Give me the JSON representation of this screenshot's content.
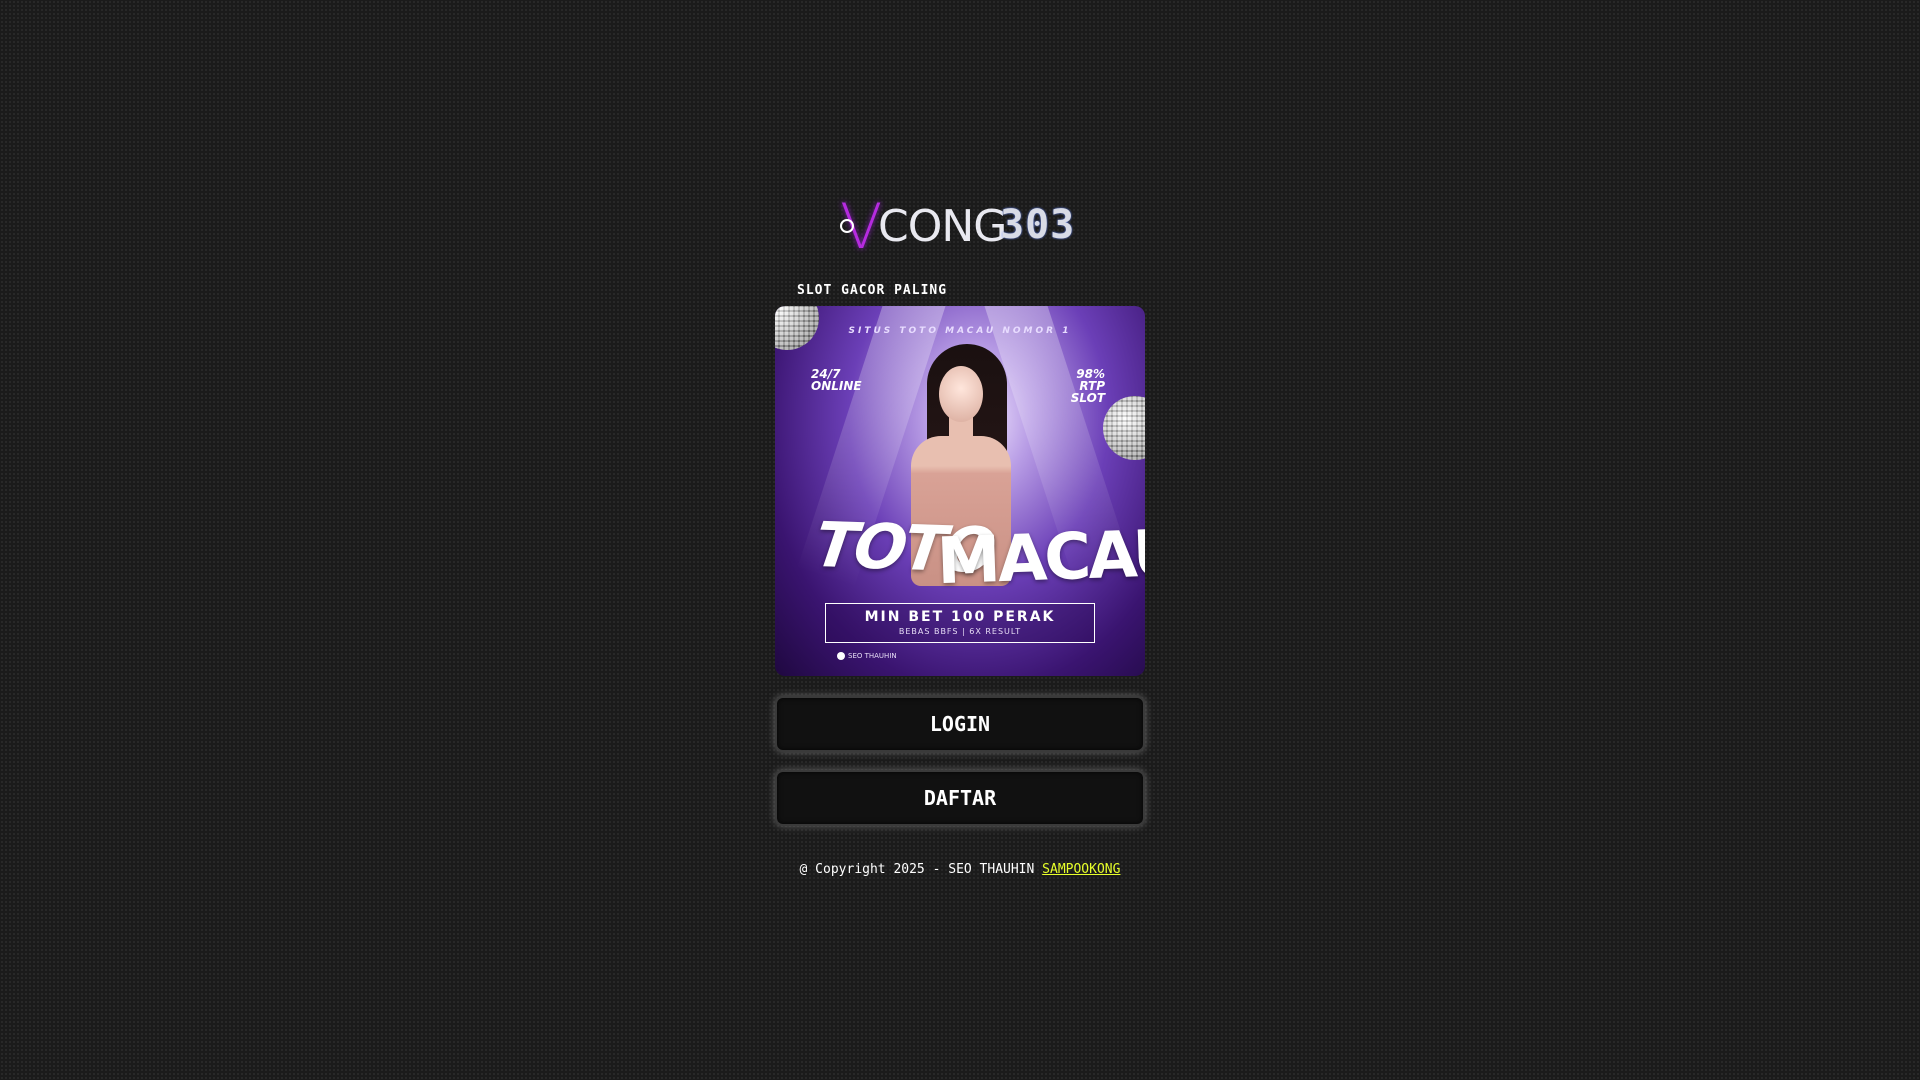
{
  "brand": {
    "logo_v": "V",
    "logo_text": "CONG",
    "logo_number": "303"
  },
  "tagline": "SLOT GACOR PALING",
  "banner": {
    "top_text": "SITUS TOTO MACAU NOMOR 1",
    "left_badge": [
      "24/7",
      "ONLINE"
    ],
    "right_badge": [
      "98%",
      "RTP",
      "SLOT"
    ],
    "title_part1": "TOTO",
    "title_part2": "MACAU",
    "min_bet": "MIN BET 100 PERAK",
    "sub_text": "BEBAS BBFS | 6X RESULT",
    "credit": "SEO THAUHIN"
  },
  "buttons": {
    "login_label": "LOGIN",
    "register_label": "DAFTAR"
  },
  "footer": {
    "copyright": "@ Copyright 2025 - SEO THAUHIN",
    "link_label": "SAMPOOKONG"
  },
  "colors": {
    "background": "#1b1b1b",
    "accent_purple": "#b62be0",
    "link_yellow": "#e7ff2a"
  }
}
